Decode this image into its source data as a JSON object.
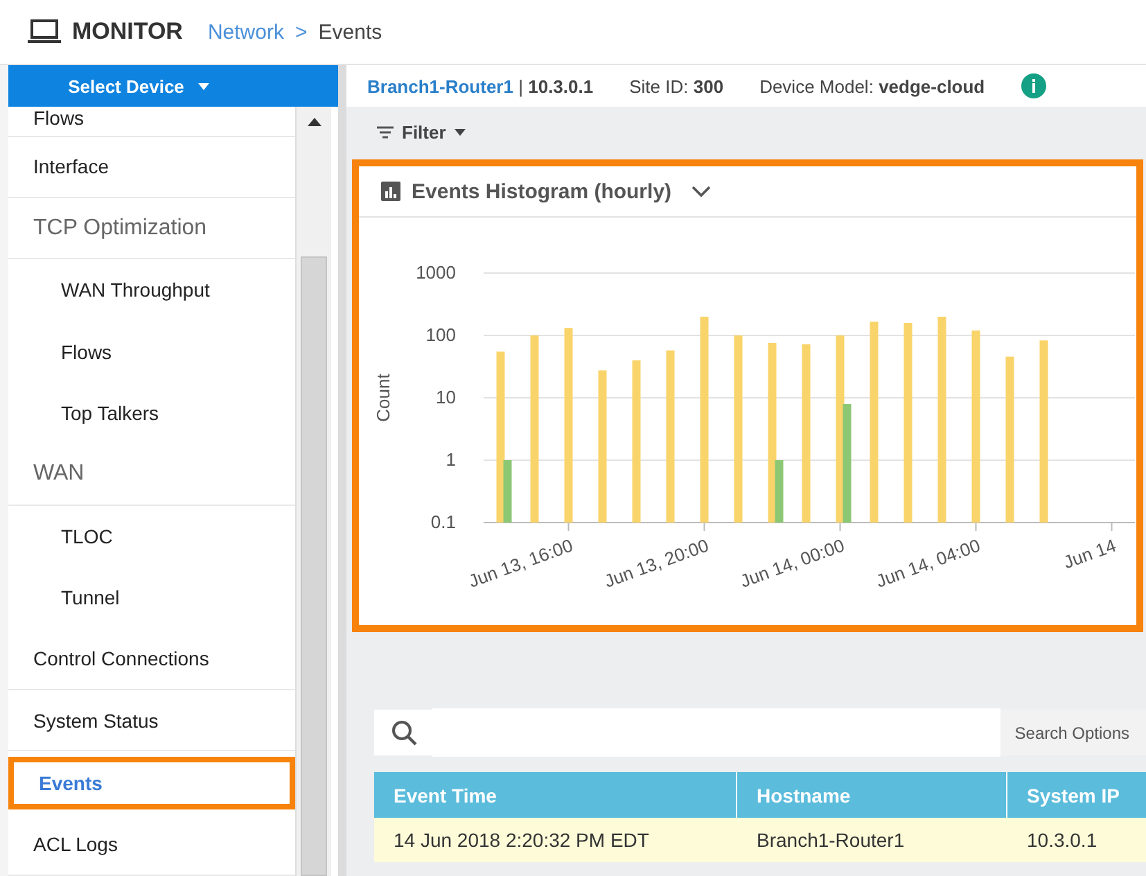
{
  "header": {
    "title": "MONITOR",
    "breadcrumb": [
      "Network",
      "Events"
    ],
    "separator": ">"
  },
  "select_device": {
    "label": "Select Device"
  },
  "device_info": {
    "name": "Branch1-Router1",
    "divider": "|",
    "ip": "10.3.0.1",
    "site_label": "Site ID:",
    "site_id": "300",
    "model_label": "Device Model:",
    "model": "vedge-cloud"
  },
  "sidebar": {
    "items": [
      {
        "label": "Flows",
        "selected": false
      },
      {
        "label": "Interface",
        "selected": false
      },
      {
        "label": "TCP Optimization",
        "selected": false,
        "children": [
          {
            "label": "WAN Throughput",
            "selected": false
          },
          {
            "label": "Flows",
            "selected": false
          },
          {
            "label": "Top Talkers",
            "selected": false
          }
        ]
      },
      {
        "label": "WAN",
        "selected": false,
        "children": [
          {
            "label": "TLOC",
            "selected": false
          },
          {
            "label": "Tunnel",
            "selected": false
          }
        ]
      },
      {
        "label": "Control Connections",
        "selected": false
      },
      {
        "label": "System Status",
        "selected": false
      },
      {
        "label": "Events",
        "selected": true
      },
      {
        "label": "ACL Logs",
        "selected": false
      }
    ]
  },
  "filter": {
    "label": "Filter"
  },
  "histogram": {
    "title": "Events Histogram (hourly)",
    "y_axis": {
      "title": "Count",
      "labels": [
        "1000",
        "100",
        "10",
        "1",
        "0.1"
      ]
    },
    "x_axis": {
      "labels": [
        "Jun 13, 16:00",
        "Jun 13, 20:00",
        "Jun 14, 00:00",
        "Jun 14, 04:00",
        "Jun 14"
      ]
    }
  },
  "search": {
    "options_label": "Search Options"
  },
  "table": {
    "columns": [
      "Event Time",
      "Hostname",
      "System IP"
    ],
    "rows": [
      [
        "14 Jun 2018 2:20:32 PM EDT",
        "Branch1-Router1",
        "10.3.0.1"
      ]
    ]
  }
}
